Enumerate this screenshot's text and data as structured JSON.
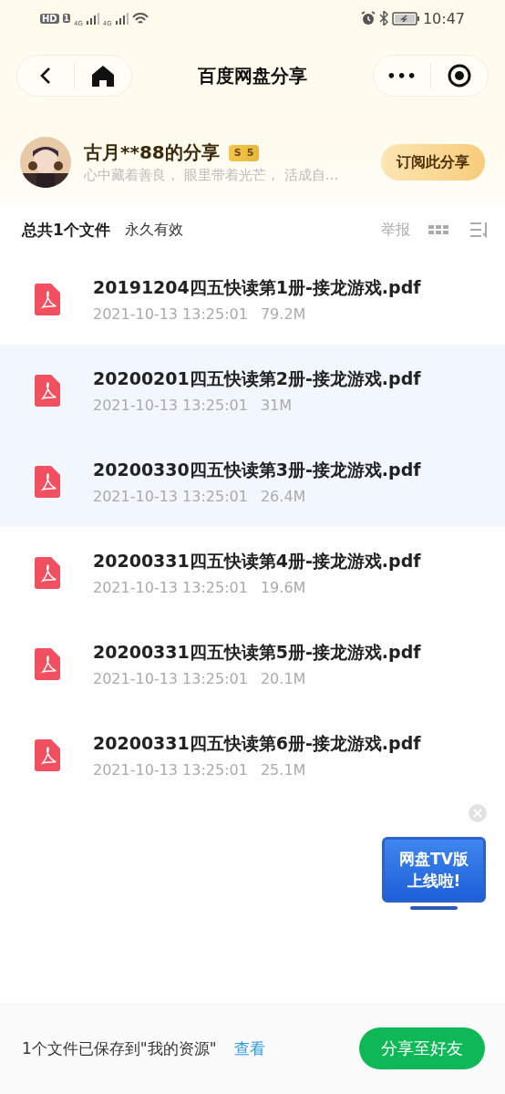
{
  "status_bar": {
    "hd": "HD",
    "sim": "1",
    "networks": [
      "4G",
      "4G"
    ],
    "time": "10:47"
  },
  "nav": {
    "title": "百度网盘分享",
    "more": "•••"
  },
  "sharer": {
    "name": "古月**88的分享",
    "badge_letter": "S",
    "badge_level": "5",
    "motto": "心中藏着善良， 眼里带着光芒， 活成自…",
    "subscribe": "订阅此分享"
  },
  "summary": {
    "count": "总共1个文件",
    "validity": "永久有效",
    "report": "举报"
  },
  "files": [
    {
      "name": "20191204四五快读第1册-接龙游戏.pdf",
      "date": "2021-10-13 13:25:01",
      "size": "79.2M",
      "selected": false
    },
    {
      "name": "20200201四五快读第2册-接龙游戏.pdf",
      "date": "2021-10-13 13:25:01",
      "size": "31M",
      "selected": true
    },
    {
      "name": "20200330四五快读第3册-接龙游戏.pdf",
      "date": "2021-10-13 13:25:01",
      "size": "26.4M",
      "selected": true
    },
    {
      "name": "20200331四五快读第4册-接龙游戏.pdf",
      "date": "2021-10-13 13:25:01",
      "size": "19.6M",
      "selected": false
    },
    {
      "name": "20200331四五快读第5册-接龙游戏.pdf",
      "date": "2021-10-13 13:25:01",
      "size": "20.1M",
      "selected": false
    },
    {
      "name": "20200331四五快读第6册-接龙游戏.pdf",
      "date": "2021-10-13 13:25:01",
      "size": "25.1M",
      "selected": false
    }
  ],
  "promo": {
    "lines": [
      "网盘TV版",
      "上线啦!"
    ]
  },
  "footer": {
    "message": "1个文件已保存到\"我的资源\"",
    "link": "查看",
    "share_button": "分享至好友"
  }
}
